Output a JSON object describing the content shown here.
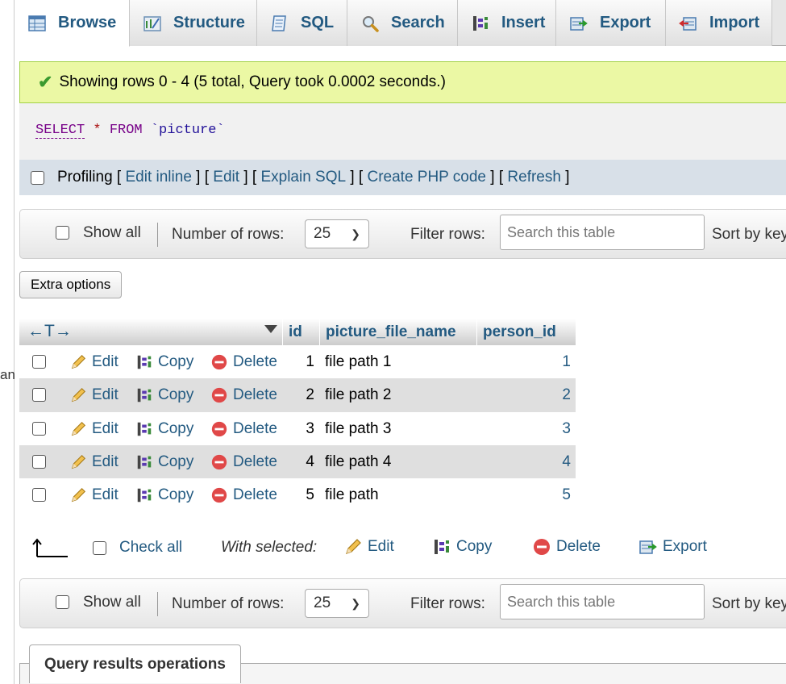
{
  "tabs": [
    {
      "label": "Browse",
      "icon": "browse-icon"
    },
    {
      "label": "Structure",
      "icon": "structure-icon"
    },
    {
      "label": "SQL",
      "icon": "sql-icon"
    },
    {
      "label": "Search",
      "icon": "search-icon"
    },
    {
      "label": "Insert",
      "icon": "insert-icon"
    },
    {
      "label": "Export",
      "icon": "export-icon"
    },
    {
      "label": "Import",
      "icon": "import-icon"
    }
  ],
  "side_text": "an",
  "success_message": "Showing rows 0 - 4 (5 total, Query took 0.0002 seconds.)",
  "sql": {
    "select": "SELECT",
    "star": "*",
    "from": "FROM",
    "table": "`picture`"
  },
  "profiling": {
    "label": "Profiling",
    "links": [
      "Edit inline",
      "Edit",
      "Explain SQL",
      "Create PHP code",
      "Refresh"
    ]
  },
  "nav": {
    "show_all": "Show all",
    "number_of_rows_label": "Number of rows:",
    "rows_value": "25",
    "filter_label": "Filter rows:",
    "search_placeholder": "Search this table",
    "sort_label": "Sort by key"
  },
  "extra_options": "Extra options",
  "table": {
    "columns": [
      "id",
      "picture_file_name",
      "person_id"
    ],
    "actions": {
      "edit": "Edit",
      "copy": "Copy",
      "delete": "Delete"
    },
    "rows": [
      {
        "id": "1",
        "picture_file_name": "file path 1",
        "person_id": "1"
      },
      {
        "id": "2",
        "picture_file_name": "file path 2",
        "person_id": "2"
      },
      {
        "id": "3",
        "picture_file_name": "file path 3",
        "person_id": "3"
      },
      {
        "id": "4",
        "picture_file_name": "file path 4",
        "person_id": "4"
      },
      {
        "id": "5",
        "picture_file_name": "file path",
        "person_id": "5"
      }
    ]
  },
  "bulk": {
    "check_all": "Check all",
    "with_selected": "With selected:",
    "edit": "Edit",
    "copy": "Copy",
    "delete": "Delete",
    "export": "Export"
  },
  "query_results_operations": "Query results operations"
}
